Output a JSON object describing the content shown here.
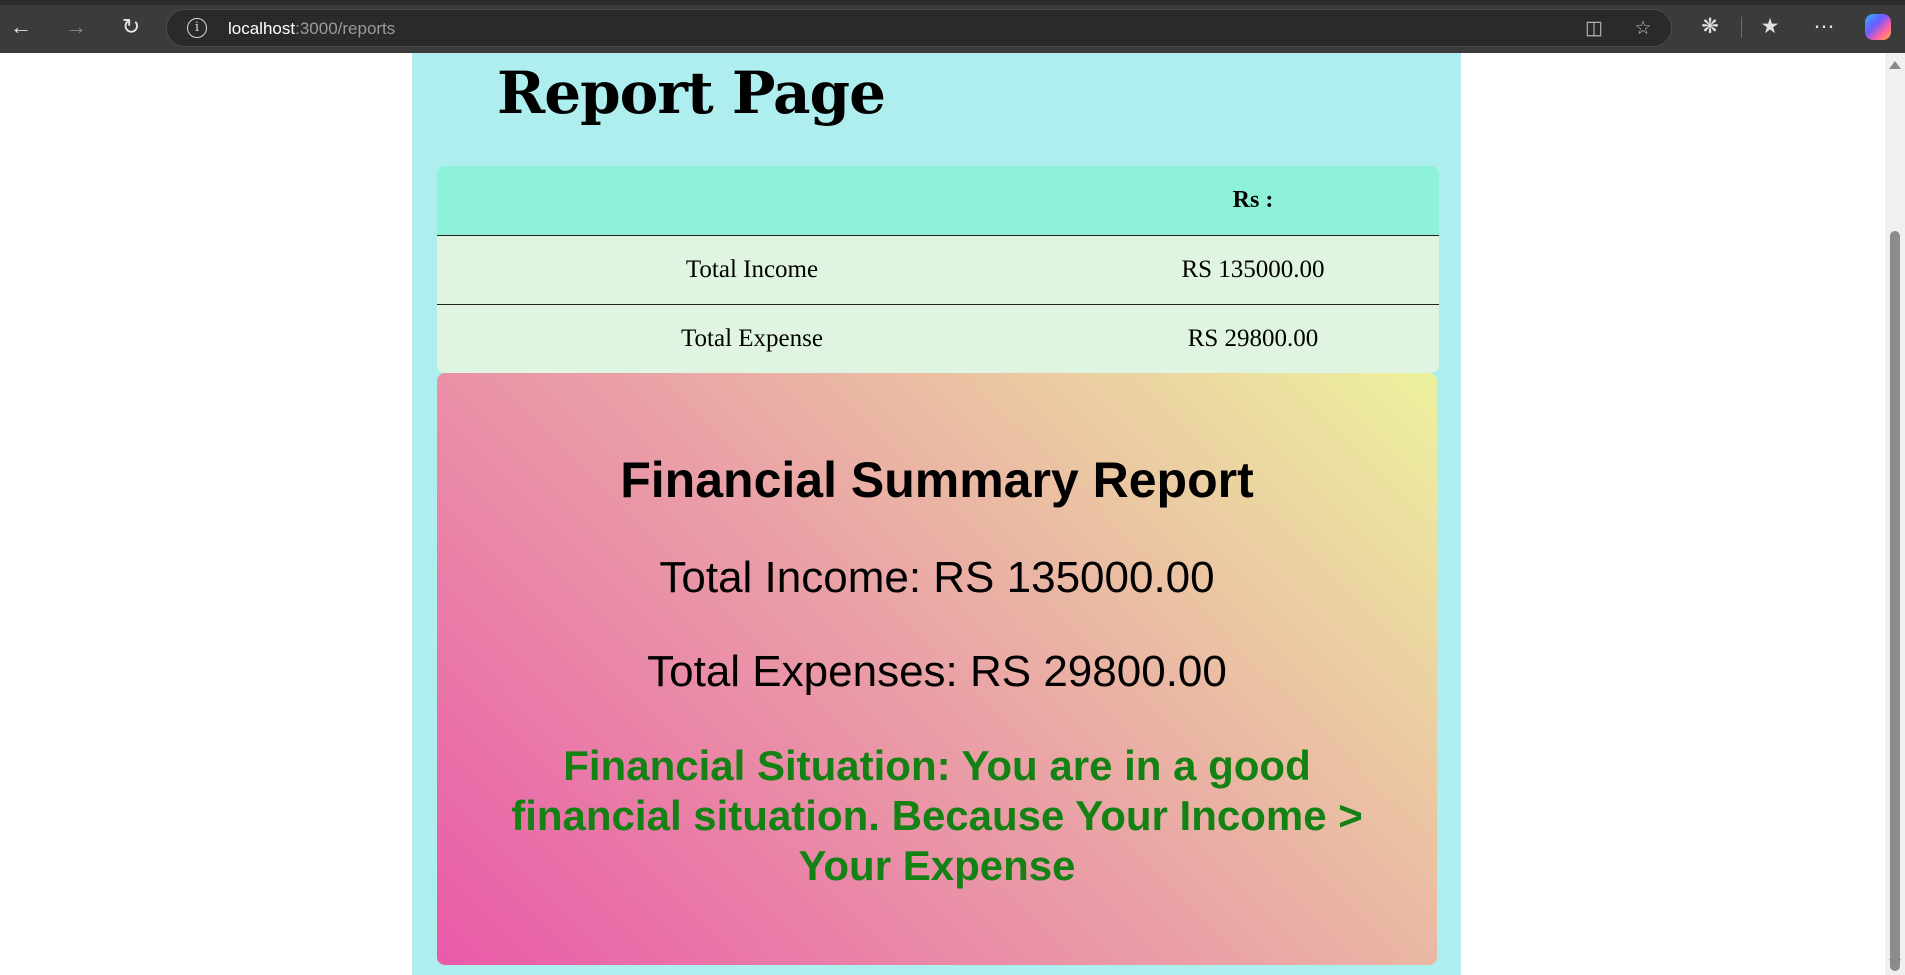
{
  "browser": {
    "url_host": "localhost",
    "url_path": ":3000/reports",
    "icons": [
      "back-arrow-icon",
      "forward-arrow-icon",
      "reload-icon",
      "site-info-icon",
      "split-screen-icon",
      "favorite-star-icon",
      "extensions-icon",
      "favorites-icon",
      "more-options-icon",
      "copilot-icon"
    ]
  },
  "page": {
    "title": "Report Page",
    "table": {
      "header": [
        "",
        "Rs :"
      ],
      "rows": [
        [
          "Total Income",
          "RS 135000.00"
        ],
        [
          "Total Expense",
          "RS 29800.00"
        ]
      ]
    },
    "summary": {
      "heading": "Financial Summary Report",
      "income": "Total Income: RS 135000.00",
      "expenses": "Total Expenses: RS 29800.00",
      "situation": "Financial Situation: You are in a good financial situation. Because Your Income > Your Expense",
      "situation_color": "#138113"
    }
  },
  "colors": {
    "container_bg": "#aeeeee",
    "table_header_bg": "#8ef2d8",
    "table_row_bg": "#dff5e1"
  }
}
